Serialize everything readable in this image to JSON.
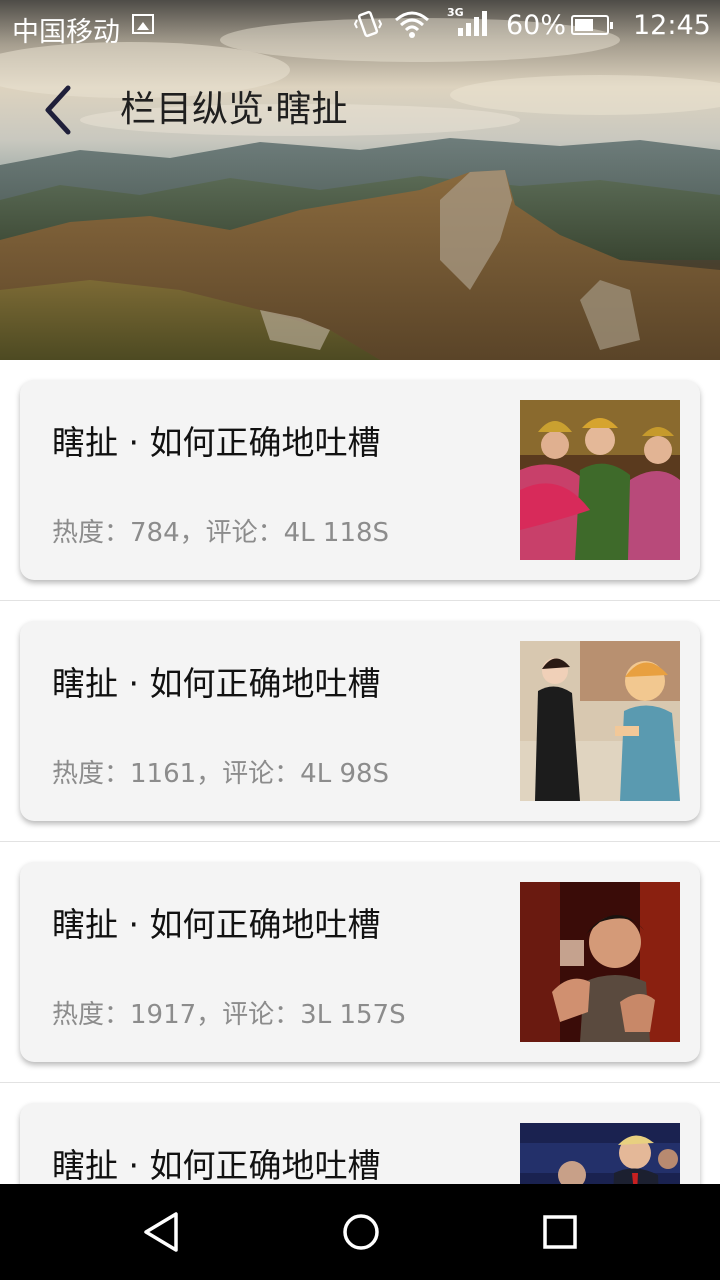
{
  "status_bar": {
    "carrier": "中国移动",
    "network_type": "3G",
    "battery_percent": "60%",
    "battery_level": 0.6,
    "time": "12:45"
  },
  "toolbar": {
    "title": "栏目纵览·瞎扯",
    "back_icon": "back-chevron-icon"
  },
  "articles": [
    {
      "title": "瞎扯 · 如何正确地吐槽",
      "meta": "热度：784，评论：4L 118S",
      "thumbnail": "costume-women-with-fans"
    },
    {
      "title": "瞎扯 · 如何正确地吐槽",
      "meta": "热度：1161，评论：4L 98S",
      "thumbnail": "woman-in-black-and-boy"
    },
    {
      "title": "瞎扯 · 如何正确地吐槽",
      "meta": "热度：1917，评论：3L 157S",
      "thumbnail": "man-holding-glass"
    },
    {
      "title": "瞎扯 · 如何正确地吐槽",
      "meta": "",
      "thumbnail": "man-speaking-at-event"
    }
  ],
  "nav_bar": {
    "back_icon": "triangle-back-icon",
    "home_icon": "circle-home-icon",
    "recents_icon": "square-recents-icon"
  },
  "colors": {
    "card_background": "#f4f4f4",
    "title_text": "#111111",
    "meta_text": "#8c8c8c",
    "nav_background": "#000000"
  }
}
